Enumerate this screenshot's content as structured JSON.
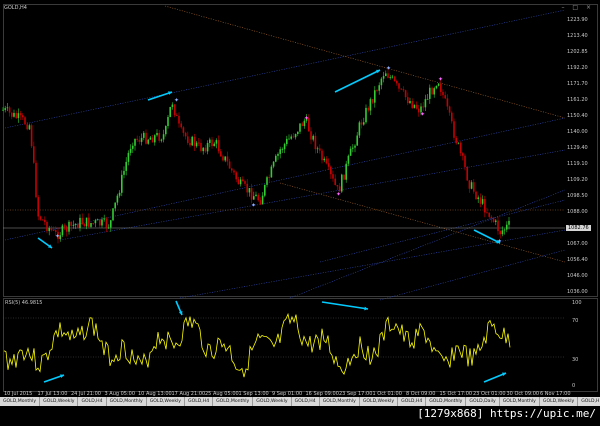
{
  "window": {
    "title": "GOLD,H4",
    "controls": [
      "–",
      "□",
      "×"
    ]
  },
  "price_axis": {
    "labels": [
      "1223.90",
      "1213.40",
      "1202.85",
      "1192.20",
      "1171.70",
      "1161.20",
      "1150.40",
      "1140.00",
      "1129.40",
      "1119.10",
      "1109.20",
      "1098.50",
      "1088.00",
      "1077.50",
      "1067.00",
      "1056.40",
      "1046.00",
      "1036.00"
    ],
    "current_price": "1082.76"
  },
  "time_axis": [
    "10 Jul 2015",
    "17 Jul 13:00",
    "24 Jul 21:00",
    "3 Aug 05:00",
    "10 Aug 13:00",
    "17 Aug 21:00",
    "25 Aug 05:00",
    "1 Sep 13:00",
    "9 Sep 01:00",
    "16 Sep 09:00",
    "23 Sep 17:00",
    "1 Oct 01:00",
    "8 Oct 09:00",
    "15 Oct 17:00",
    "23 Oct 01:00",
    "30 Oct 09:00",
    "6 Nov 17:00"
  ],
  "rsi": {
    "label": "RSI(5) 46.9815",
    "levels": [
      "100",
      "70",
      "30",
      "0"
    ]
  },
  "tabs": [
    "GOLD,Monthly",
    "GOLD,Weekly",
    "GOLD,H4",
    "GOLD,Monthly",
    "GOLD,Weekly",
    "GOLD,H4",
    "GOLD,Monthly",
    "GOLD,Weekly",
    "GOLD,H4",
    "GOLD,Monthly",
    "GOLD,Weekly",
    "GOLD,H4",
    "GOLD,Monthly",
    "GOLD,Daily",
    "GOLD,Monthly",
    "GOLD,Weekly",
    "GOLD,H1",
    "GOLD,Monthly",
    "GOLD,Daily",
    "GOLD,H4",
    "GOLD,Daily",
    "GOLD,H4",
    "GOLD,H4"
  ],
  "active_tab": "GOLD,H4",
  "watermark": "[1279x868] https://upic.me/",
  "colors": {
    "bull": "#32cd32",
    "bear": "#c80000",
    "rsi": "#ffff00",
    "arrow": "#00ccff",
    "trend": "#2f4fbf",
    "fib": "#b36b2a"
  }
}
